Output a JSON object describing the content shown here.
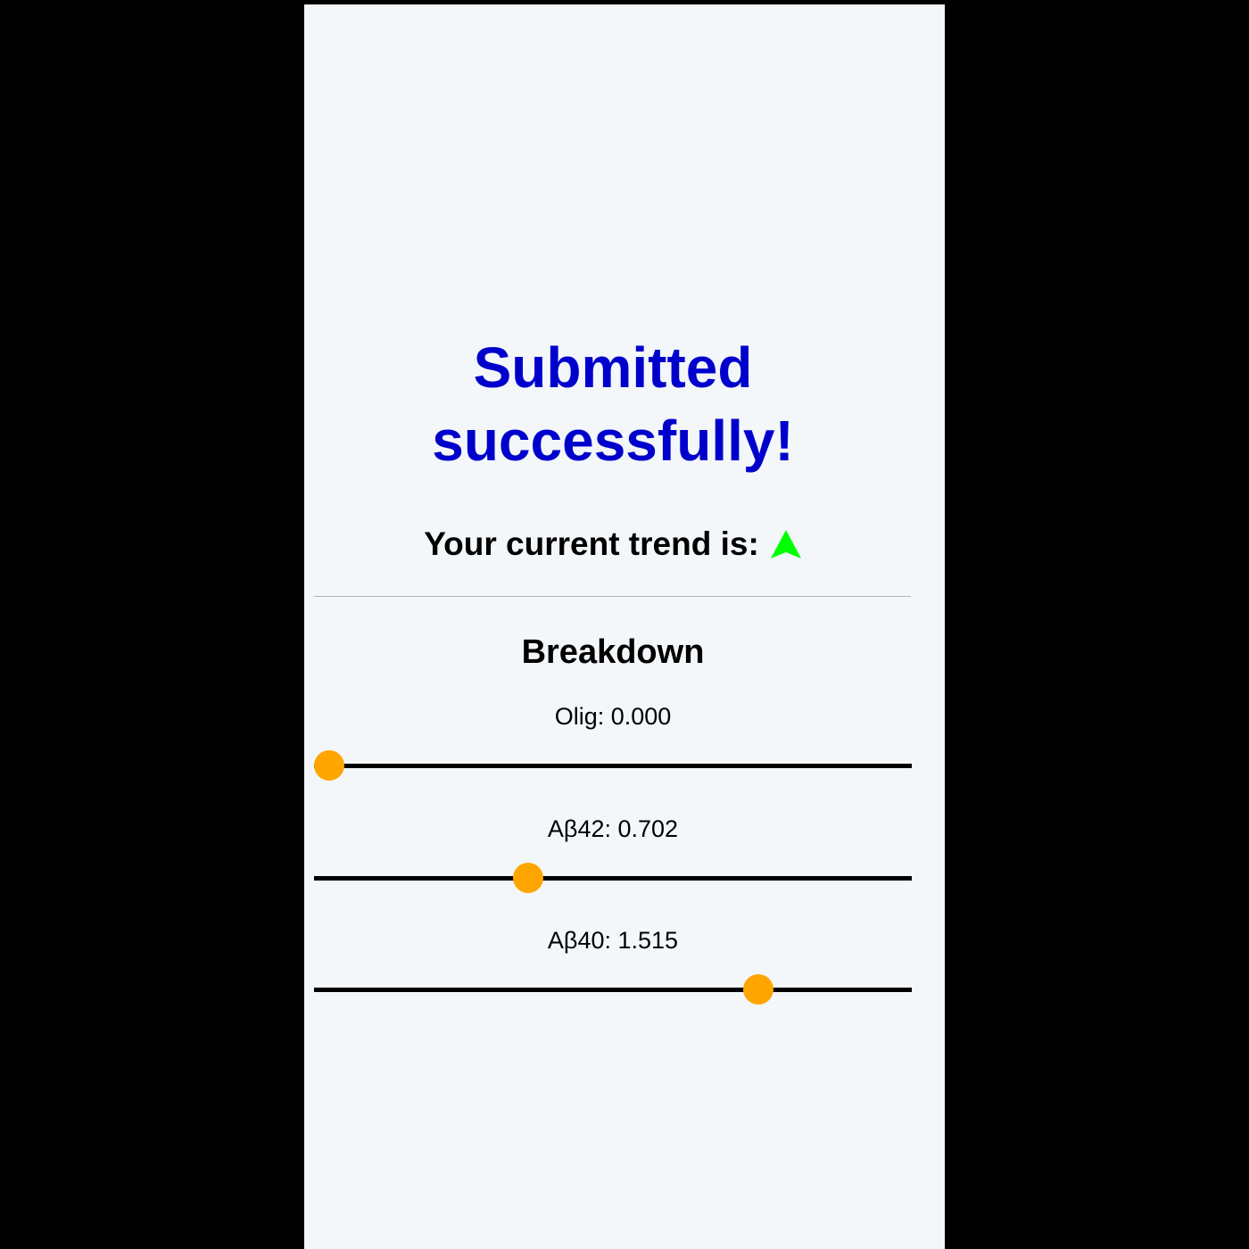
{
  "page": {
    "title": "Submitted successfully!",
    "trend_label": "Your current trend is:",
    "trend_icon": "up-arrow-icon",
    "trend_color": "#00ff00",
    "title_color": "#0000cc",
    "breakdown_heading": "Breakdown"
  },
  "metrics": [
    {
      "label": "Olig: 0.000",
      "value": 0.0,
      "position_fraction": 0.0
    },
    {
      "label": "Aβ42: 0.702",
      "value": 0.702,
      "position_fraction": 0.35
    },
    {
      "label": "Aβ40: 1.515",
      "value": 1.515,
      "position_fraction": 0.756
    }
  ],
  "colors": {
    "slider_thumb": "#ffa500",
    "slider_track": "#000000",
    "background": "#f4f7fa"
  }
}
